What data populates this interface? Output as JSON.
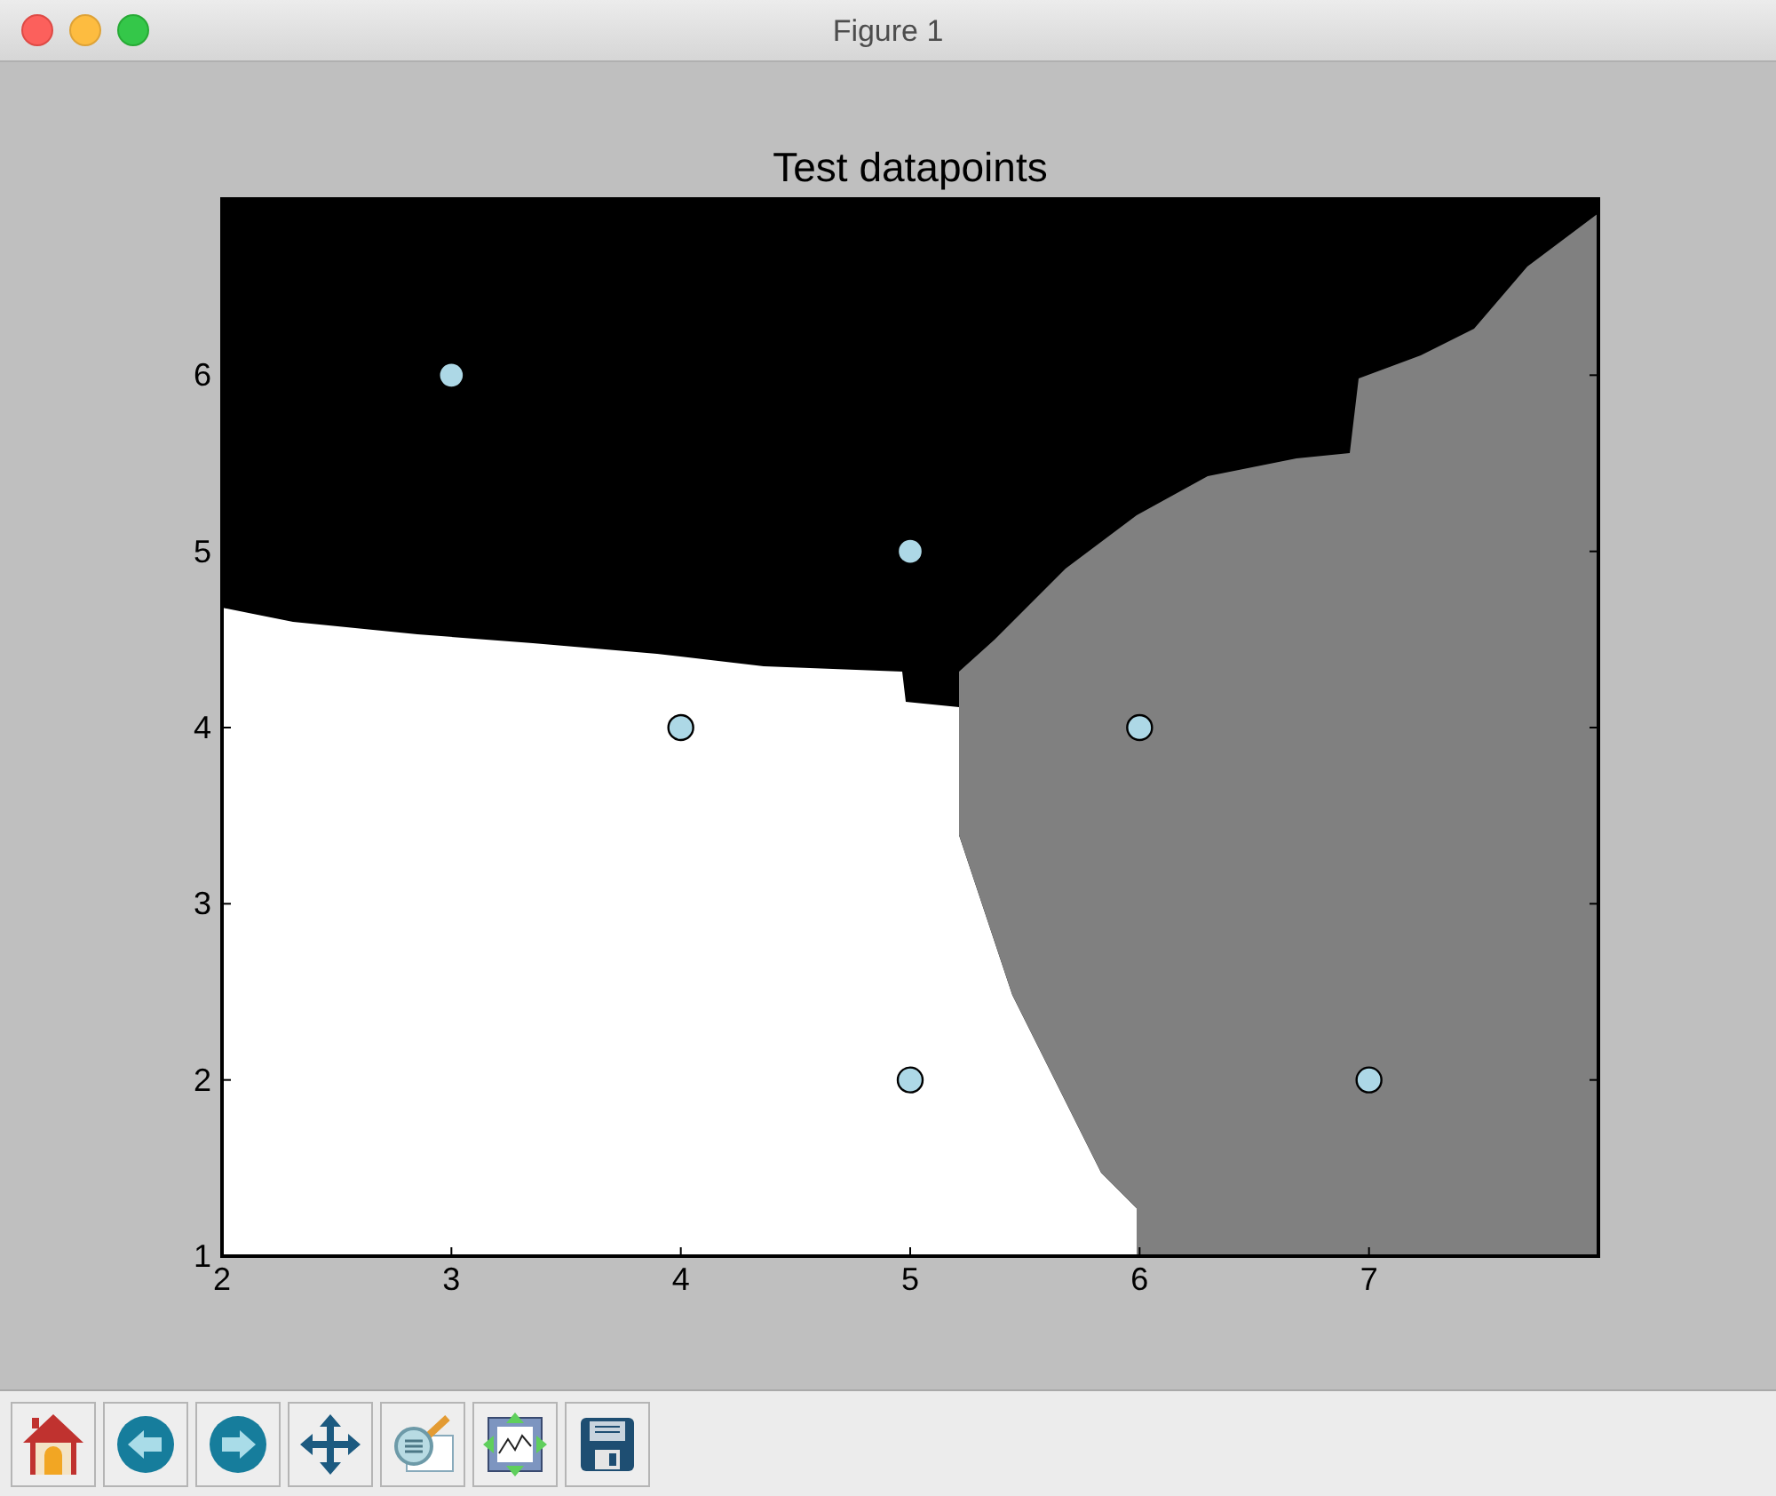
{
  "window": {
    "title": "Figure 1"
  },
  "figure": {
    "chart_data": {
      "type": "scatter",
      "title": "Test datapoints",
      "xlim": [
        2,
        8
      ],
      "ylim": [
        1,
        7
      ],
      "xticks": [
        2,
        3,
        4,
        5,
        6,
        7
      ],
      "yticks": [
        1,
        2,
        3,
        4,
        5,
        6
      ],
      "series": [
        {
          "color": "#add8e6",
          "x": [
            3,
            5,
            4,
            6,
            5,
            7
          ],
          "values": [
            6,
            5,
            4,
            4,
            2,
            2
          ]
        }
      ]
    }
  }
}
